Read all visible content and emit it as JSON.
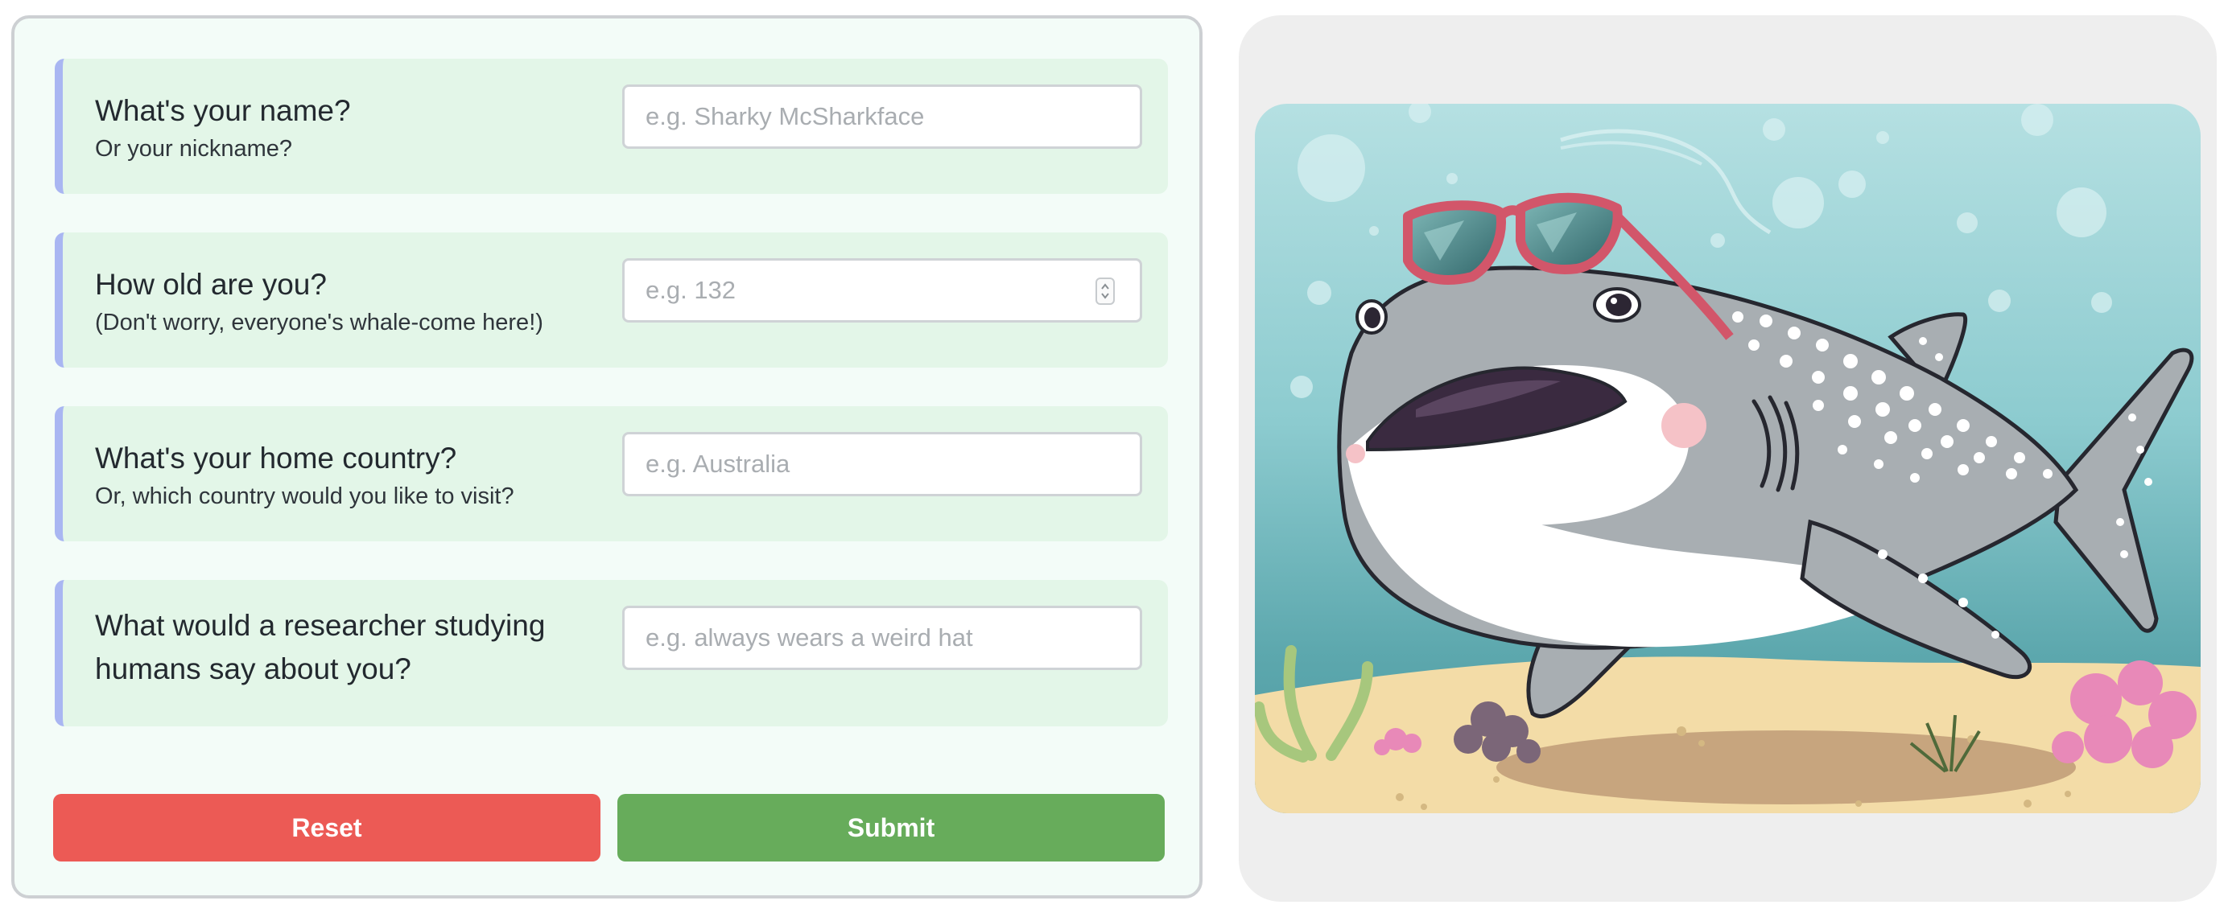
{
  "form": {
    "fields": [
      {
        "title": "What's your name?",
        "subtitle": "Or your nickname?",
        "placeholder": "e.g. Sharky McSharkface"
      },
      {
        "title": "How old are you?",
        "subtitle": "(Don't worry, everyone's whale-come here!)",
        "placeholder": "e.g. 132"
      },
      {
        "title": "What's your home country?",
        "subtitle": "Or, which country would you like to visit?",
        "placeholder": "e.g. Australia"
      },
      {
        "title": "What would a researcher studying humans say about you?",
        "subtitle": "",
        "placeholder": "e.g. always wears a weird hat"
      }
    ],
    "reset_label": "Reset",
    "submit_label": "Submit"
  },
  "illustration": {
    "subject": "whale-shark-with-sunglasses-icon"
  },
  "colors": {
    "panel_bg": "#f3fcf8",
    "field_bg": "#e3f6e8",
    "field_accent": "#a9b6f2",
    "reset": "#ec5a55",
    "submit": "#67ac5b",
    "image_panel_bg": "#eeeeee"
  }
}
